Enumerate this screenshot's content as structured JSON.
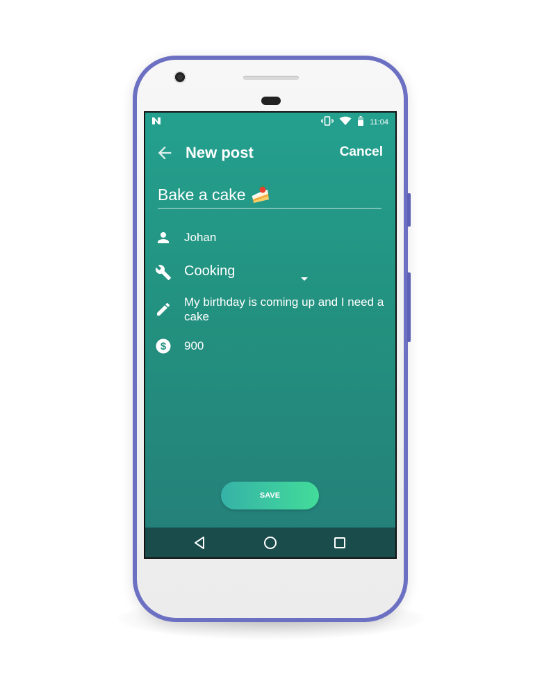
{
  "status_bar": {
    "notification_icon": "n-icon",
    "icons": [
      "vibrate-icon",
      "wifi-icon",
      "battery-icon"
    ],
    "time": "11:04"
  },
  "app_bar": {
    "back_icon": "arrow-back-icon",
    "title": "New post",
    "cancel_label": "Cancel"
  },
  "form": {
    "title_value": "Bake a cake",
    "title_emoji": "cake-emoji",
    "author": "Johan",
    "category": "Cooking",
    "description": "My birthday is coming up and I need a cake",
    "price": "900"
  },
  "save_label": "SAVE",
  "nav_bar": [
    "back-triangle-icon",
    "home-circle-icon",
    "recents-square-icon"
  ],
  "colors": {
    "phone_frame": "#6b70c2",
    "screen_gradient_top": "#24a08f",
    "screen_gradient_bottom": "#247f79",
    "save_gradient_start": "#36b2a7",
    "save_gradient_end": "#42dc9a",
    "nav_bar": "#194c4b"
  }
}
